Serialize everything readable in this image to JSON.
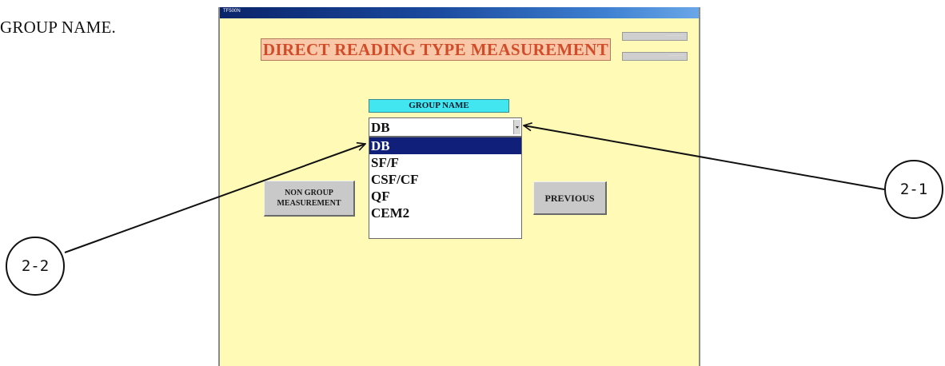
{
  "doc": {
    "caption": "GROUP NAME."
  },
  "window": {
    "title": "TF500N"
  },
  "screen": {
    "title": "DIRECT READING TYPE MEASUREMENT",
    "status_1": "···········",
    "status_2": "·········"
  },
  "group_select": {
    "label": "GROUP NAME",
    "value": "DB",
    "options": [
      "DB",
      "SF/F",
      "CSF/CF",
      "QF",
      "CEM2"
    ],
    "selected_index": 0
  },
  "buttons": {
    "non_group": "NON GROUP MEASUREMENT",
    "non_group_line1": "NON GROUP",
    "non_group_line2": "MEASUREMENT",
    "previous": "PREVIOUS"
  },
  "annotations": {
    "callout_1": "2-1",
    "callout_2": "2-2"
  },
  "colors": {
    "window_bg": "#fffbb6",
    "title_bg": "#f8c8a8",
    "title_text": "#d24c2a",
    "group_label_bg": "#41e6f0",
    "selected_item_bg": "#0f1f7a",
    "button_bg": "#c9c9c9"
  }
}
